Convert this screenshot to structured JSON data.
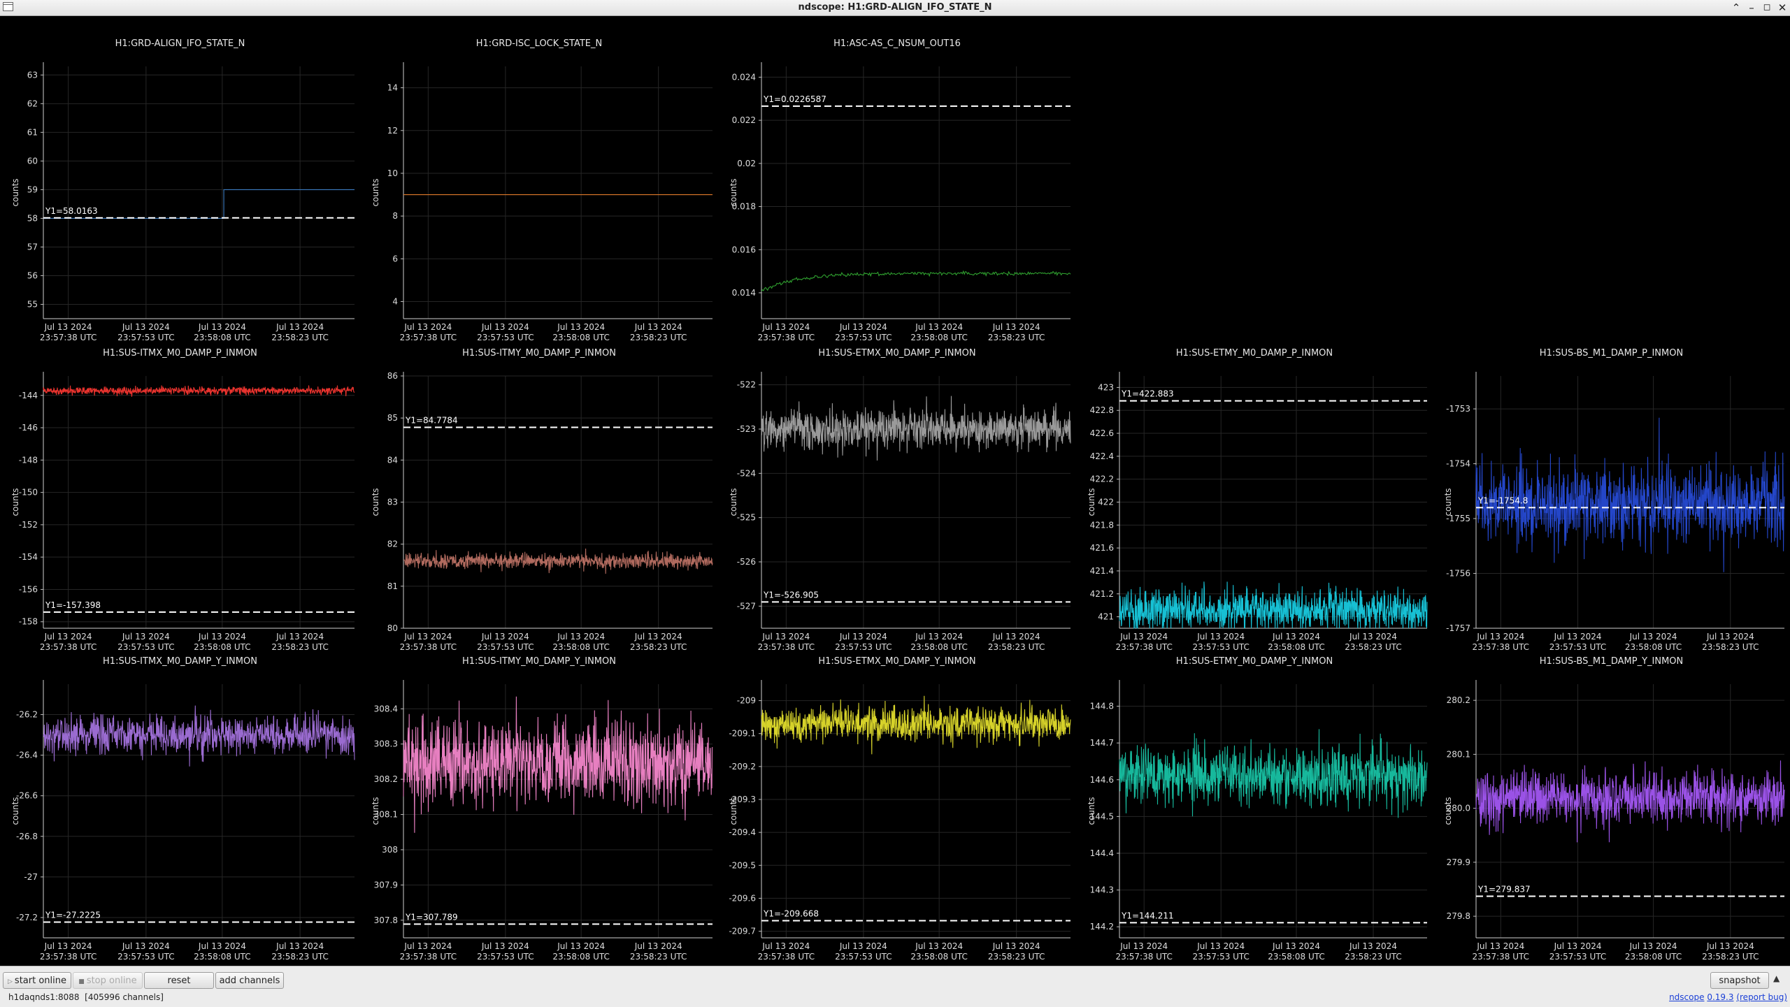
{
  "window": {
    "title": "ndscope: H1:GRD-ALIGN_IFO_STATE_N",
    "icons": [
      "app-icon",
      "minimize-up-icon",
      "minimize-icon",
      "maximize-icon",
      "close-icon"
    ]
  },
  "plots": [
    {
      "id": "align",
      "title": "H1:GRD-ALIGN_IFO_STATE_N",
      "ylabel": "counts",
      "ymin": 54.5,
      "ymax": 63.3,
      "yticks": [
        "55",
        "56",
        "57",
        "58",
        "59",
        "60",
        "61",
        "62",
        "63"
      ],
      "xticks": [
        {
          "date": "Jul 13 2024",
          "time": "23:57:38 UTC"
        },
        {
          "date": "Jul 13 2024",
          "time": "23:57:53 UTC"
        },
        {
          "date": "Jul 13 2024",
          "time": "23:58:08 UTC"
        },
        {
          "date": "Jul 13 2024",
          "time": "23:58:23 UTC"
        }
      ],
      "color": "#3b7bc0",
      "trace": {
        "kind": "step",
        "levels": [
          58,
          59
        ],
        "step_at": 0.58
      },
      "cursor": {
        "value": 58.0163,
        "label": "Y1=58.0163"
      }
    },
    {
      "id": "isc",
      "title": "H1:GRD-ISC_LOCK_STATE_N",
      "ylabel": "counts",
      "ymin": 3.2,
      "ymax": 15.0,
      "yticks": [
        "4",
        "6",
        "8",
        "10",
        "12",
        "14"
      ],
      "xticks": [
        {
          "date": "Jul 13 2024",
          "time": "23:57:38 UTC"
        },
        {
          "date": "Jul 13 2024",
          "time": "23:57:53 UTC"
        },
        {
          "date": "Jul 13 2024",
          "time": "23:58:08 UTC"
        },
        {
          "date": "Jul 13 2024",
          "time": "23:58:23 UTC"
        }
      ],
      "color": "#e07a2a",
      "trace": {
        "kind": "flat",
        "value": 9
      },
      "cursor": null
    },
    {
      "id": "asc",
      "title": "H1:ASC-AS_C_NSUM_OUT16",
      "ylabel": "counts",
      "ymin": 0.0128,
      "ymax": 0.0245,
      "yticks": [
        "0.014",
        "0.016",
        "0.018",
        "0.02",
        "0.022",
        "0.024"
      ],
      "xticks": [
        {
          "date": "Jul 13 2024",
          "time": "23:57:38 UTC"
        },
        {
          "date": "Jul 13 2024",
          "time": "23:57:53 UTC"
        },
        {
          "date": "Jul 13 2024",
          "time": "23:58:08 UTC"
        },
        {
          "date": "Jul 13 2024",
          "time": "23:58:23 UTC"
        }
      ],
      "color": "#2fa02f",
      "trace": {
        "kind": "rise",
        "start": 0.0141,
        "level": 0.0149,
        "noise": 4e-05
      },
      "cursor": {
        "value": 0.0226587,
        "label": "Y1=0.0226587"
      }
    },
    {
      "id": "itmx_p",
      "title": "H1:SUS-ITMX_M0_DAMP_P_INMON",
      "ylabel": "counts",
      "ymin": -158.4,
      "ymax": -142.8,
      "yticks": [
        "-144",
        "-146",
        "-148",
        "-150",
        "-152",
        "-154",
        "-156",
        "-158"
      ],
      "xticks": [
        {
          "date": "Jul 13 2024",
          "time": "23:57:38 UTC"
        },
        {
          "date": "Jul 13 2024",
          "time": "23:57:53 UTC"
        },
        {
          "date": "Jul 13 2024",
          "time": "23:58:08 UTC"
        },
        {
          "date": "Jul 13 2024",
          "time": "23:58:23 UTC"
        }
      ],
      "color": "#e8332e",
      "trace": {
        "kind": "noise",
        "center": -143.7,
        "amp": 0.12
      },
      "cursor": {
        "value": -157.398,
        "label": "Y1=-157.398"
      }
    },
    {
      "id": "itmy_p",
      "title": "H1:SUS-ITMY_M0_DAMP_P_INMON",
      "ylabel": "counts",
      "ymin": 80.0,
      "ymax": 86.0,
      "yticks": [
        "80",
        "81",
        "82",
        "83",
        "84",
        "85",
        "86"
      ],
      "xticks": [
        {
          "date": "Jul 13 2024",
          "time": "23:57:38 UTC"
        },
        {
          "date": "Jul 13 2024",
          "time": "23:57:53 UTC"
        },
        {
          "date": "Jul 13 2024",
          "time": "23:58:08 UTC"
        },
        {
          "date": "Jul 13 2024",
          "time": "23:58:23 UTC"
        }
      ],
      "color": "#b06a5e",
      "trace": {
        "kind": "noise",
        "center": 81.6,
        "amp": 0.09
      },
      "cursor": {
        "value": 84.7784,
        "label": "Y1=84.7784"
      }
    },
    {
      "id": "etmx_p",
      "title": "H1:SUS-ETMX_M0_DAMP_P_INMON",
      "ylabel": "counts",
      "ymin": -527.5,
      "ymax": -521.8,
      "yticks": [
        "-522",
        "-523",
        "-524",
        "-525",
        "-526",
        "-527"
      ],
      "xticks": [
        {
          "date": "Jul 13 2024",
          "time": "23:57:38 UTC"
        },
        {
          "date": "Jul 13 2024",
          "time": "23:57:53 UTC"
        },
        {
          "date": "Jul 13 2024",
          "time": "23:58:08 UTC"
        },
        {
          "date": "Jul 13 2024",
          "time": "23:58:23 UTC"
        }
      ],
      "color": "#9a9a9a",
      "trace": {
        "kind": "noise",
        "center": -523.0,
        "amp": 0.22
      },
      "cursor": {
        "value": -526.905,
        "label": "Y1=-526.905"
      }
    },
    {
      "id": "etmy_p",
      "title": "H1:SUS-ETMY_M0_DAMP_P_INMON",
      "ylabel": "counts",
      "ymin": 420.9,
      "ymax": 423.1,
      "yticks": [
        "421",
        "421.2",
        "421.4",
        "421.6",
        "421.8",
        "422",
        "422.2",
        "422.4",
        "422.6",
        "422.8",
        "423"
      ],
      "xticks": [
        {
          "date": "Jul 13 2024",
          "time": "23:57:38 UTC"
        },
        {
          "date": "Jul 13 2024",
          "time": "23:57:53 UTC"
        },
        {
          "date": "Jul 13 2024",
          "time": "23:58:08 UTC"
        },
        {
          "date": "Jul 13 2024",
          "time": "23:58:23 UTC"
        }
      ],
      "color": "#17c0d4",
      "trace": {
        "kind": "noise",
        "center": 421.06,
        "amp": 0.09
      },
      "cursor": {
        "value": 422.883,
        "label": "Y1=422.883"
      }
    },
    {
      "id": "bs_p",
      "title": "H1:SUS-BS_M1_DAMP_P_INMON",
      "ylabel": "counts",
      "ymin": -1757.0,
      "ymax": -1752.4,
      "yticks": [
        "-1753",
        "-1754",
        "-1755",
        "-1756",
        "-1757"
      ],
      "xticks": [
        {
          "date": "Jul 13 2024",
          "time": "23:57:38 UTC"
        },
        {
          "date": "Jul 13 2024",
          "time": "23:57:53 UTC"
        },
        {
          "date": "Jul 13 2024",
          "time": "23:58:08 UTC"
        },
        {
          "date": "Jul 13 2024",
          "time": "23:58:23 UTC"
        }
      ],
      "color": "#2446c8",
      "trace": {
        "kind": "noise",
        "center": -1754.75,
        "amp": 0.35
      },
      "cursor": {
        "value": -1754.8,
        "label": "Y1=-1754.8"
      }
    },
    {
      "id": "itmx_y",
      "title": "H1:SUS-ITMX_M0_DAMP_Y_INMON",
      "ylabel": "counts",
      "ymin": -27.3,
      "ymax": -26.05,
      "yticks": [
        "-26.2",
        "-26.4",
        "-26.6",
        "-26.8",
        "-27",
        "-27.2"
      ],
      "xticks": [
        {
          "date": "Jul 13 2024",
          "time": "23:57:38 UTC"
        },
        {
          "date": "Jul 13 2024",
          "time": "23:57:53 UTC"
        },
        {
          "date": "Jul 13 2024",
          "time": "23:58:08 UTC"
        },
        {
          "date": "Jul 13 2024",
          "time": "23:58:23 UTC"
        }
      ],
      "color": "#9a6bd0",
      "trace": {
        "kind": "noise",
        "center": -26.3,
        "amp": 0.045
      },
      "cursor": {
        "value": -27.2225,
        "label": "Y1=-27.2225"
      }
    },
    {
      "id": "itmy_y",
      "title": "H1:SUS-ITMY_M0_DAMP_Y_INMON",
      "ylabel": "counts",
      "ymin": 307.75,
      "ymax": 308.47,
      "yticks": [
        "307.8",
        "307.9",
        "308",
        "308.1",
        "308.2",
        "308.3",
        "308.4"
      ],
      "xticks": [
        {
          "date": "Jul 13 2024",
          "time": "23:57:38 UTC"
        },
        {
          "date": "Jul 13 2024",
          "time": "23:57:53 UTC"
        },
        {
          "date": "Jul 13 2024",
          "time": "23:58:08 UTC"
        },
        {
          "date": "Jul 13 2024",
          "time": "23:58:23 UTC"
        }
      ],
      "color": "#e77fc0",
      "trace": {
        "kind": "noise",
        "center": 308.25,
        "amp": 0.06
      },
      "cursor": {
        "value": 307.789,
        "label": "Y1=307.789"
      }
    },
    {
      "id": "etmx_y",
      "title": "H1:SUS-ETMX_M0_DAMP_Y_INMON",
      "ylabel": "counts",
      "ymin": -209.72,
      "ymax": -208.95,
      "yticks": [
        "-209",
        "-209.1",
        "-209.2",
        "-209.3",
        "-209.4",
        "-209.5",
        "-209.6",
        "-209.7"
      ],
      "xticks": [
        {
          "date": "Jul 13 2024",
          "time": "23:57:38 UTC"
        },
        {
          "date": "Jul 13 2024",
          "time": "23:57:53 UTC"
        },
        {
          "date": "Jul 13 2024",
          "time": "23:58:08 UTC"
        },
        {
          "date": "Jul 13 2024",
          "time": "23:58:23 UTC"
        }
      ],
      "color": "#d6d22a",
      "trace": {
        "kind": "noise",
        "center": -209.07,
        "amp": 0.025
      },
      "cursor": {
        "value": -209.668,
        "label": "Y1=-209.668"
      }
    },
    {
      "id": "etmy_y",
      "title": "H1:SUS-ETMY_M0_DAMP_Y_INMON",
      "ylabel": "counts",
      "ymin": 144.17,
      "ymax": 144.86,
      "yticks": [
        "144.2",
        "144.3",
        "144.4",
        "144.5",
        "144.6",
        "144.7",
        "144.8"
      ],
      "xticks": [
        {
          "date": "Jul 13 2024",
          "time": "23:57:38 UTC"
        },
        {
          "date": "Jul 13 2024",
          "time": "23:57:53 UTC"
        },
        {
          "date": "Jul 13 2024",
          "time": "23:58:08 UTC"
        },
        {
          "date": "Jul 13 2024",
          "time": "23:58:23 UTC"
        }
      ],
      "color": "#17b89c",
      "trace": {
        "kind": "noise",
        "center": 144.61,
        "amp": 0.04
      },
      "cursor": {
        "value": 144.211,
        "label": "Y1=144.211"
      }
    },
    {
      "id": "bs_y",
      "title": "H1:SUS-BS_M1_DAMP_Y_INMON",
      "ylabel": "counts",
      "ymin": 279.76,
      "ymax": 280.23,
      "yticks": [
        "279.8",
        "279.9",
        "280.0",
        "280.1",
        "280.2"
      ],
      "xticks": [
        {
          "date": "Jul 13 2024",
          "time": "23:57:38 UTC"
        },
        {
          "date": "Jul 13 2024",
          "time": "23:57:53 UTC"
        },
        {
          "date": "Jul 13 2024",
          "time": "23:58:08 UTC"
        },
        {
          "date": "Jul 13 2024",
          "time": "23:58:23 UTC"
        }
      ],
      "color": "#9a52e6",
      "trace": {
        "kind": "noise",
        "center": 280.02,
        "amp": 0.025
      },
      "cursor": {
        "value": 279.837,
        "label": "Y1=279.837"
      }
    }
  ],
  "toolbar": {
    "start_online": "start online",
    "stop_online": "stop online",
    "reset": "reset",
    "add_channels": "add channels",
    "snapshot": "snapshot"
  },
  "status": {
    "server": "h1daqnds1:8088",
    "channels": "[405996 channels]",
    "app_name": "ndscope",
    "version": "0.19.3",
    "report_bug": "(report bug)"
  }
}
